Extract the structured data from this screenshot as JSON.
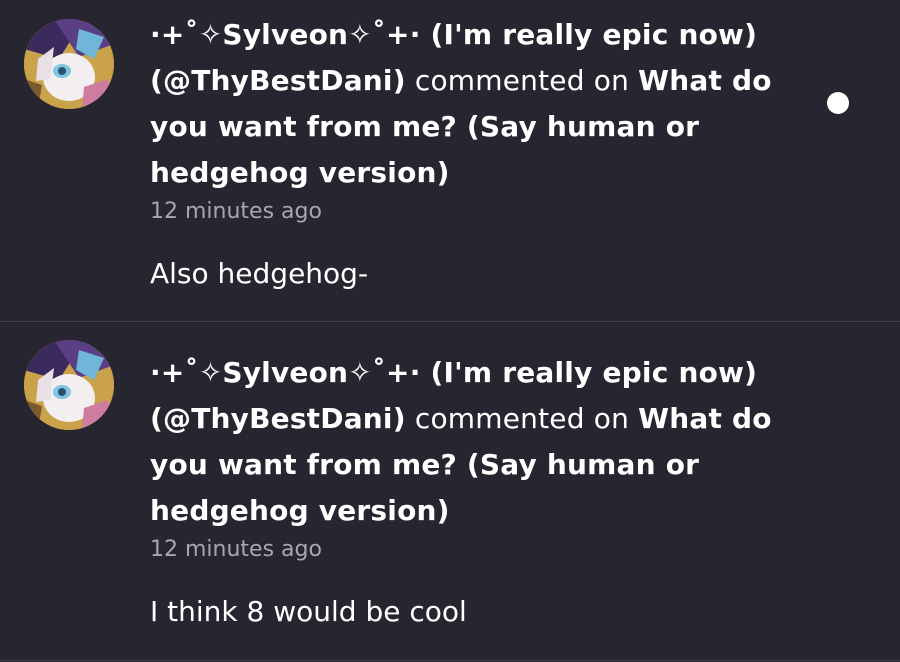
{
  "notifications": [
    {
      "user_display": "·+˚✧Sylveon✧˚+· (I'm really epic now)",
      "handle": "(@ThyBestDani)",
      "verb": "commented on",
      "post_title": "What do you want from me? (Say human or hedgehog version)",
      "time": "12 minutes ago",
      "comment": "Also hedgehog-",
      "unread": true
    },
    {
      "user_display": "·+˚✧Sylveon✧˚+· (I'm really epic now)",
      "handle": "(@ThyBestDani)",
      "verb": "commented on",
      "post_title": "What do you want from me? (Say human or hedgehog version)",
      "time": "12 minutes ago",
      "comment": "I think 8 would be cool",
      "unread": false
    }
  ],
  "colors": {
    "background": "#272530",
    "divider": "#3e3c47",
    "text": "#ffffff",
    "muted_text": "#a8a6b0",
    "unread_dot": "#ffffff"
  },
  "icons": {
    "avatar": "sylveon-avatar-image",
    "unread": "unread-dot"
  }
}
